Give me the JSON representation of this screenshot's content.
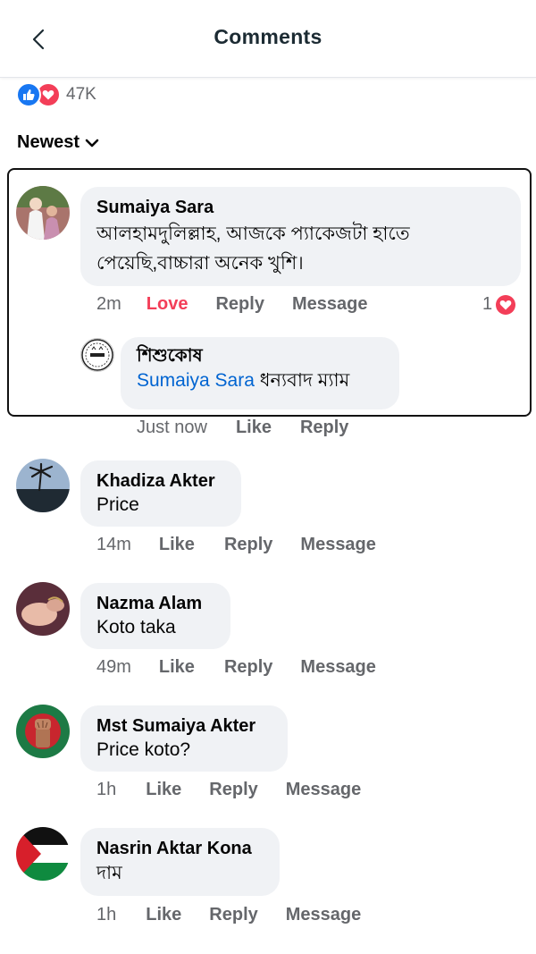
{
  "header": {
    "title": "Comments"
  },
  "reactions": {
    "count": "47K"
  },
  "sort": {
    "label": "Newest"
  },
  "colors": {
    "accent": "#1877f2",
    "love": "#f33e58",
    "mention": "#0064d1"
  },
  "comments": [
    {
      "author": "Sumaiya Sara",
      "text": "আলহামদুলিল্লাহ, আজকে প্যাকেজটা হাতে পেয়েছি,বাচ্চারা অনেক খুশি।",
      "time": "2m",
      "react_label": "Love",
      "reply_label": "Reply",
      "message_label": "Message",
      "reaction_count": "1",
      "reply": {
        "author": "শিশুকোষ",
        "mention": "Sumaiya Sara",
        "text": "ধন্যবাদ ম্যাম",
        "time": "Just now",
        "like_label": "Like",
        "reply_label": "Reply"
      }
    },
    {
      "author": "Khadiza Akter",
      "text": "Price",
      "time": "14m",
      "like_label": "Like",
      "reply_label": "Reply",
      "message_label": "Message"
    },
    {
      "author": "Nazma Alam",
      "text": "Koto taka",
      "time": "49m",
      "like_label": "Like",
      "reply_label": "Reply",
      "message_label": "Message"
    },
    {
      "author": "Mst Sumaiya Akter",
      "text": "Price koto?",
      "time": "1h",
      "like_label": "Like",
      "reply_label": "Reply",
      "message_label": "Message"
    },
    {
      "author": "Nasrin Aktar Kona",
      "text": "দাম",
      "time": "1h",
      "like_label": "Like",
      "reply_label": "Reply",
      "message_label": "Message"
    }
  ]
}
